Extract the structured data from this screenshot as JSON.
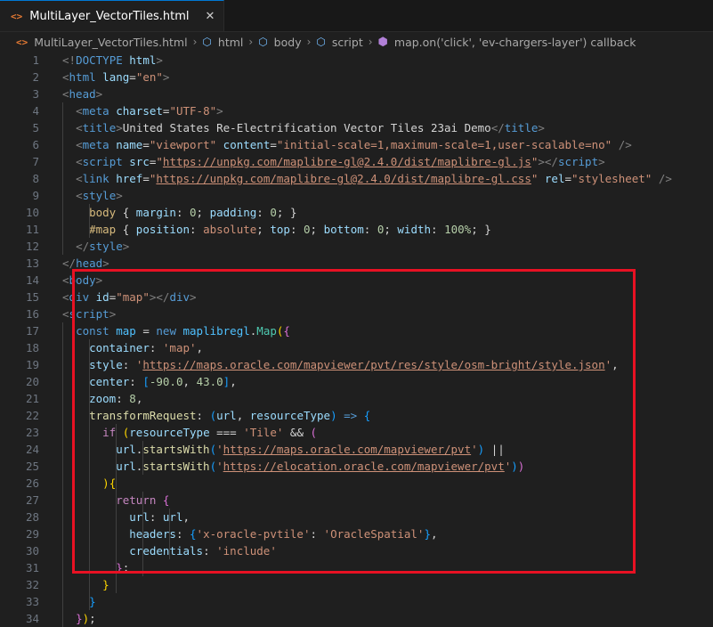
{
  "tab": {
    "filename": "MultiLayer_VectorTiles.html",
    "icon": "<>",
    "close": "✕"
  },
  "breadcrumb": {
    "file": "MultiLayer_VectorTiles.html",
    "items": [
      "html",
      "body",
      "script",
      "map.on('click', 'ev-chargers-layer') callback"
    ]
  },
  "lines": [
    {
      "n": "1",
      "tokens": [
        [
          "<!",
          "t-br"
        ],
        [
          "DOCTYPE",
          "t-tag"
        ],
        [
          " html",
          "t-attr"
        ],
        [
          ">",
          "t-br"
        ]
      ]
    },
    {
      "n": "2",
      "tokens": [
        [
          "<",
          "t-br"
        ],
        [
          "html",
          "t-tag"
        ],
        [
          " lang",
          "t-attr"
        ],
        [
          "=",
          "t-op"
        ],
        [
          "\"en\"",
          "t-str"
        ],
        [
          ">",
          "t-br"
        ]
      ]
    },
    {
      "n": "3",
      "tokens": [
        [
          "<",
          "t-br"
        ],
        [
          "head",
          "t-tag"
        ],
        [
          ">",
          "t-br"
        ]
      ]
    },
    {
      "n": "4",
      "indent": 1,
      "tokens": [
        [
          "<",
          "t-br"
        ],
        [
          "meta",
          "t-tag"
        ],
        [
          " charset",
          "t-attr"
        ],
        [
          "=",
          "t-op"
        ],
        [
          "\"UTF-8\"",
          "t-str"
        ],
        [
          ">",
          "t-br"
        ]
      ]
    },
    {
      "n": "5",
      "indent": 1,
      "tokens": [
        [
          "<",
          "t-br"
        ],
        [
          "title",
          "t-tag"
        ],
        [
          ">",
          "t-br"
        ],
        [
          "United States Re-Electrification Vector Tiles 23ai Demo",
          "t-txt"
        ],
        [
          "</",
          "t-br"
        ],
        [
          "title",
          "t-tag"
        ],
        [
          ">",
          "t-br"
        ]
      ]
    },
    {
      "n": "6",
      "indent": 1,
      "tokens": [
        [
          "<",
          "t-br"
        ],
        [
          "meta",
          "t-tag"
        ],
        [
          " name",
          "t-attr"
        ],
        [
          "=",
          "t-op"
        ],
        [
          "\"viewport\"",
          "t-str"
        ],
        [
          " content",
          "t-attr"
        ],
        [
          "=",
          "t-op"
        ],
        [
          "\"initial-scale=1,maximum-scale=1,user-scalable=no\"",
          "t-str"
        ],
        [
          " />",
          "t-br"
        ]
      ]
    },
    {
      "n": "7",
      "indent": 1,
      "tokens": [
        [
          "<",
          "t-br"
        ],
        [
          "script",
          "t-tag"
        ],
        [
          " src",
          "t-attr"
        ],
        [
          "=",
          "t-op"
        ],
        [
          "\"",
          "t-str"
        ],
        [
          "https://unpkg.com/maplibre-gl@2.4.0/dist/maplibre-gl.js",
          "t-url"
        ],
        [
          "\"",
          "t-str"
        ],
        [
          "></",
          "t-br"
        ],
        [
          "script",
          "t-tag"
        ],
        [
          ">",
          "t-br"
        ]
      ]
    },
    {
      "n": "8",
      "indent": 1,
      "tokens": [
        [
          "<",
          "t-br"
        ],
        [
          "link",
          "t-tag"
        ],
        [
          " href",
          "t-attr"
        ],
        [
          "=",
          "t-op"
        ],
        [
          "\"",
          "t-str"
        ],
        [
          "https://unpkg.com/maplibre-gl@2.4.0/dist/maplibre-gl.css",
          "t-url"
        ],
        [
          "\"",
          "t-str"
        ],
        [
          " rel",
          "t-attr"
        ],
        [
          "=",
          "t-op"
        ],
        [
          "\"stylesheet\"",
          "t-str"
        ],
        [
          " />",
          "t-br"
        ]
      ]
    },
    {
      "n": "9",
      "indent": 1,
      "tokens": [
        [
          "<",
          "t-br"
        ],
        [
          "style",
          "t-tag"
        ],
        [
          ">",
          "t-br"
        ]
      ]
    },
    {
      "n": "10",
      "indent": 2,
      "tokens": [
        [
          "body",
          "t-sel"
        ],
        [
          " { ",
          "t-op"
        ],
        [
          "margin",
          "t-prop"
        ],
        [
          ": ",
          "t-op"
        ],
        [
          "0",
          "t-num"
        ],
        [
          "; ",
          "t-op"
        ],
        [
          "padding",
          "t-prop"
        ],
        [
          ": ",
          "t-op"
        ],
        [
          "0",
          "t-num"
        ],
        [
          "; }",
          "t-op"
        ]
      ]
    },
    {
      "n": "11",
      "indent": 2,
      "tokens": [
        [
          "#map",
          "t-sel"
        ],
        [
          " { ",
          "t-op"
        ],
        [
          "position",
          "t-prop"
        ],
        [
          ": ",
          "t-op"
        ],
        [
          "absolute",
          "t-str"
        ],
        [
          "; ",
          "t-op"
        ],
        [
          "top",
          "t-prop"
        ],
        [
          ": ",
          "t-op"
        ],
        [
          "0",
          "t-num"
        ],
        [
          "; ",
          "t-op"
        ],
        [
          "bottom",
          "t-prop"
        ],
        [
          ": ",
          "t-op"
        ],
        [
          "0",
          "t-num"
        ],
        [
          "; ",
          "t-op"
        ],
        [
          "width",
          "t-prop"
        ],
        [
          ": ",
          "t-op"
        ],
        [
          "100%",
          "t-num"
        ],
        [
          "; }",
          "t-op"
        ]
      ]
    },
    {
      "n": "12",
      "indent": 1,
      "tokens": [
        [
          "</",
          "t-br"
        ],
        [
          "style",
          "t-tag"
        ],
        [
          ">",
          "t-br"
        ]
      ]
    },
    {
      "n": "13",
      "tokens": [
        [
          "</",
          "t-br"
        ],
        [
          "head",
          "t-tag"
        ],
        [
          ">",
          "t-br"
        ]
      ]
    },
    {
      "n": "14",
      "tokens": [
        [
          "<",
          "t-br"
        ],
        [
          "body",
          "t-tag"
        ],
        [
          ">",
          "t-br"
        ]
      ]
    },
    {
      "n": "15",
      "tokens": [
        [
          "<",
          "t-br"
        ],
        [
          "div",
          "t-tag"
        ],
        [
          " id",
          "t-attr"
        ],
        [
          "=",
          "t-op"
        ],
        [
          "\"map\"",
          "t-str"
        ],
        [
          "></",
          "t-br"
        ],
        [
          "div",
          "t-tag"
        ],
        [
          ">",
          "t-br"
        ]
      ]
    },
    {
      "n": "16",
      "tokens": [
        [
          "<",
          "t-br"
        ],
        [
          "script",
          "t-tag"
        ],
        [
          ">",
          "t-br"
        ]
      ]
    },
    {
      "n": "17",
      "indent": 1,
      "tokens": [
        [
          "const",
          "t-kw"
        ],
        [
          " ",
          "t-op"
        ],
        [
          "map",
          "t-var"
        ],
        [
          " = ",
          "t-op"
        ],
        [
          "new",
          "t-kw"
        ],
        [
          " ",
          "t-op"
        ],
        [
          "maplibregl",
          "t-var"
        ],
        [
          ".",
          "t-op"
        ],
        [
          "Map",
          "t-cls"
        ],
        [
          "(",
          "t-p1"
        ],
        [
          "{",
          "t-p2"
        ]
      ]
    },
    {
      "n": "18",
      "indent": 2,
      "tokens": [
        [
          "container",
          "t-prop"
        ],
        [
          ": ",
          "t-op"
        ],
        [
          "'map'",
          "t-str"
        ],
        [
          ",",
          "t-op"
        ]
      ]
    },
    {
      "n": "19",
      "indent": 2,
      "tokens": [
        [
          "style",
          "t-prop"
        ],
        [
          ": ",
          "t-op"
        ],
        [
          "'",
          "t-str"
        ],
        [
          "https://maps.oracle.com/mapviewer/pvt/res/style/osm-bright/style.json",
          "t-url"
        ],
        [
          "'",
          "t-str"
        ],
        [
          ",",
          "t-op"
        ]
      ]
    },
    {
      "n": "20",
      "indent": 2,
      "tokens": [
        [
          "center",
          "t-prop"
        ],
        [
          ": ",
          "t-op"
        ],
        [
          "[",
          "t-p3"
        ],
        [
          "-90.0",
          "t-num"
        ],
        [
          ", ",
          "t-op"
        ],
        [
          "43.0",
          "t-num"
        ],
        [
          "]",
          "t-p3"
        ],
        [
          ",",
          "t-op"
        ]
      ]
    },
    {
      "n": "21",
      "indent": 2,
      "tokens": [
        [
          "zoom",
          "t-prop"
        ],
        [
          ": ",
          "t-op"
        ],
        [
          "8",
          "t-num"
        ],
        [
          ",",
          "t-op"
        ]
      ]
    },
    {
      "n": "22",
      "indent": 2,
      "tokens": [
        [
          "transformRequest",
          "t-fn"
        ],
        [
          ": ",
          "t-op"
        ],
        [
          "(",
          "t-p3"
        ],
        [
          "url",
          "t-prop"
        ],
        [
          ", ",
          "t-op"
        ],
        [
          "resourceType",
          "t-prop"
        ],
        [
          ")",
          "t-p3"
        ],
        [
          " ",
          "t-op"
        ],
        [
          "=>",
          "t-kw"
        ],
        [
          " ",
          "t-op"
        ],
        [
          "{",
          "t-p3"
        ]
      ]
    },
    {
      "n": "23",
      "indent": 3,
      "tokens": [
        [
          "if",
          "t-ctl"
        ],
        [
          " ",
          "t-op"
        ],
        [
          "(",
          "t-p1"
        ],
        [
          "resourceType",
          "t-prop"
        ],
        [
          " === ",
          "t-op"
        ],
        [
          "'Tile'",
          "t-str"
        ],
        [
          " && ",
          "t-op"
        ],
        [
          "(",
          "t-p2"
        ]
      ]
    },
    {
      "n": "24",
      "indent": 4,
      "tokens": [
        [
          "url",
          "t-prop"
        ],
        [
          ".",
          "t-op"
        ],
        [
          "startsWith",
          "t-fn"
        ],
        [
          "(",
          "t-p3"
        ],
        [
          "'",
          "t-str"
        ],
        [
          "https://maps.oracle.com/mapviewer/pvt",
          "t-url"
        ],
        [
          "'",
          "t-str"
        ],
        [
          ")",
          "t-p3"
        ],
        [
          " ||",
          "t-op"
        ]
      ]
    },
    {
      "n": "25",
      "indent": 4,
      "tokens": [
        [
          "url",
          "t-prop"
        ],
        [
          ".",
          "t-op"
        ],
        [
          "startsWith",
          "t-fn"
        ],
        [
          "(",
          "t-p3"
        ],
        [
          "'",
          "t-str"
        ],
        [
          "https://elocation.oracle.com/mapviewer/pvt",
          "t-url"
        ],
        [
          "'",
          "t-str"
        ],
        [
          ")",
          "t-p3"
        ],
        [
          ")",
          "t-p2"
        ]
      ]
    },
    {
      "n": "26",
      "indent": 3,
      "tokens": [
        [
          ")",
          "t-p1"
        ],
        [
          "{",
          "t-p1"
        ]
      ]
    },
    {
      "n": "27",
      "indent": 4,
      "tokens": [
        [
          "return",
          "t-ctl"
        ],
        [
          " ",
          "t-op"
        ],
        [
          "{",
          "t-p2"
        ]
      ]
    },
    {
      "n": "28",
      "indent": 5,
      "tokens": [
        [
          "url",
          "t-prop"
        ],
        [
          ": ",
          "t-op"
        ],
        [
          "url",
          "t-prop"
        ],
        [
          ",",
          "t-op"
        ]
      ]
    },
    {
      "n": "29",
      "indent": 5,
      "tokens": [
        [
          "headers",
          "t-prop"
        ],
        [
          ": ",
          "t-op"
        ],
        [
          "{",
          "t-p3"
        ],
        [
          "'x-oracle-pvtile'",
          "t-str"
        ],
        [
          ": ",
          "t-op"
        ],
        [
          "'OracleSpatial'",
          "t-str"
        ],
        [
          "}",
          "t-p3"
        ],
        [
          ",",
          "t-op"
        ]
      ]
    },
    {
      "n": "30",
      "indent": 5,
      "tokens": [
        [
          "credentials",
          "t-prop"
        ],
        [
          ": ",
          "t-op"
        ],
        [
          "'include'",
          "t-str"
        ]
      ]
    },
    {
      "n": "31",
      "indent": 4,
      "tokens": [
        [
          "}",
          "t-p2"
        ],
        [
          ";",
          "t-op"
        ]
      ]
    },
    {
      "n": "32",
      "indent": 3,
      "tokens": [
        [
          "}",
          "t-p1"
        ]
      ]
    },
    {
      "n": "33",
      "indent": 2,
      "tokens": [
        [
          "}",
          "t-p3"
        ]
      ]
    },
    {
      "n": "34",
      "indent": 1,
      "tokens": [
        [
          "}",
          "t-p2"
        ],
        [
          ")",
          "t-p1"
        ],
        [
          ";",
          "t-op"
        ]
      ]
    }
  ]
}
